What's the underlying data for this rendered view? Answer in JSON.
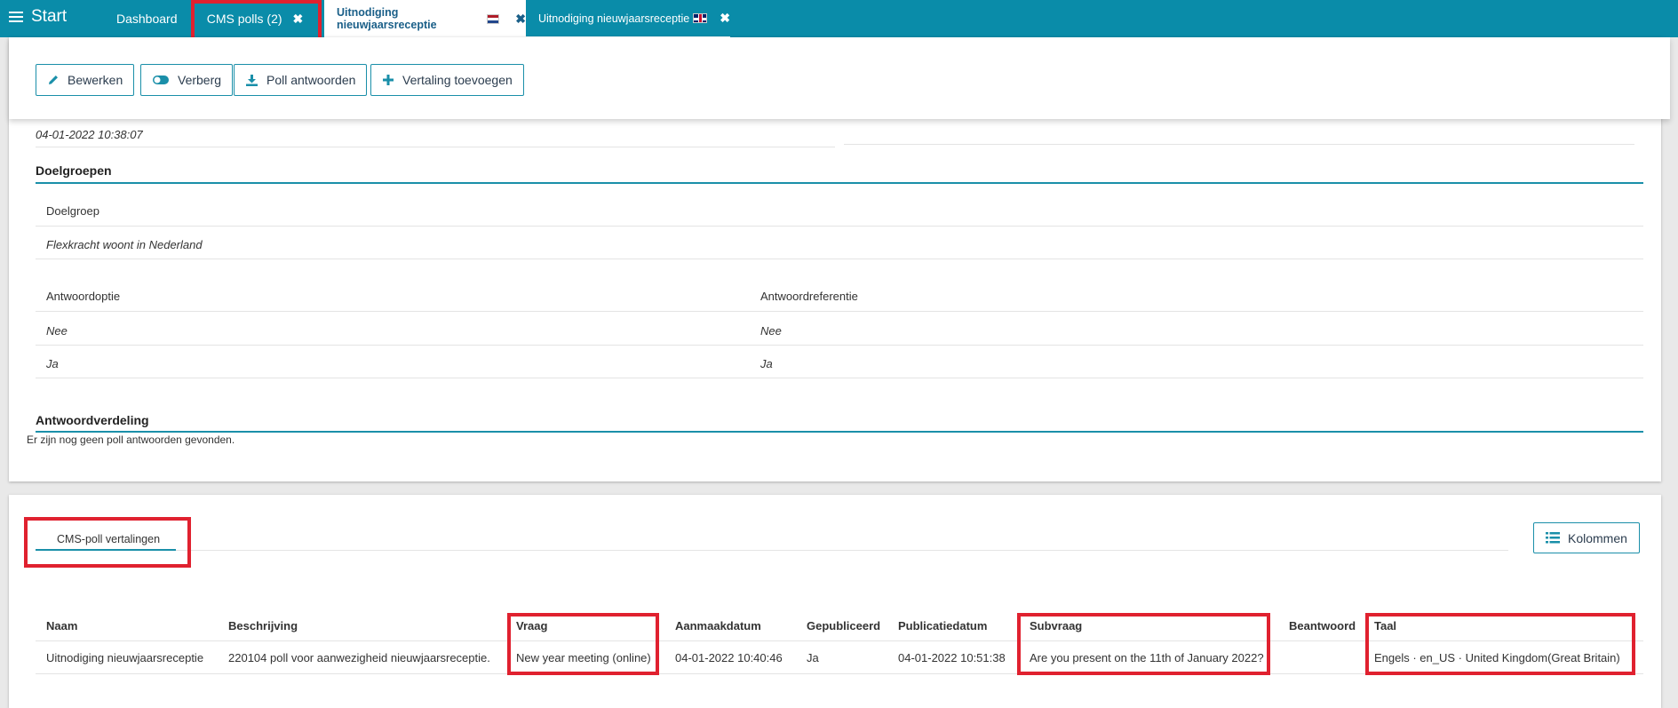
{
  "topbar": {
    "menu_label": "Start",
    "tabs": [
      {
        "label": "Dashboard"
      },
      {
        "label": "CMS polls (2)"
      },
      {
        "label": "Uitnodiging nieuwjaarsreceptie",
        "flag": "nl"
      },
      {
        "label": "Uitnodiging nieuwjaarsreceptie",
        "flag": "uk"
      }
    ]
  },
  "toolbar": {
    "buttons": [
      {
        "label": "Bewerken",
        "icon": "pencil-icon"
      },
      {
        "label": "Verberg",
        "icon": "toggle-icon"
      },
      {
        "label": "Poll antwoorden",
        "icon": "download-icon"
      },
      {
        "label": "Vertaling toevoegen",
        "icon": "plus-icon"
      }
    ]
  },
  "details": {
    "created_value": "04-01-2022 10:38:07",
    "doelgroepen_title": "Doelgroepen",
    "doelgroep_header": "Doelgroep",
    "doelgroep_value": "Flexkracht woont in Nederland",
    "answers_headers": [
      "Antwoordoptie",
      "Antwoordreferentie"
    ],
    "answers": [
      [
        "Nee",
        "Nee"
      ],
      [
        "Ja",
        "Ja"
      ]
    ],
    "verdeling_title": "Antwoordverdeling",
    "verdeling_empty": "Er zijn nog geen poll antwoorden gevonden."
  },
  "translations": {
    "tab_label": "CMS-poll vertalingen",
    "columns_button": "Kolommen",
    "headers": [
      "Naam",
      "Beschrijving",
      "Vraag",
      "Aanmaakdatum",
      "Gepubliceerd",
      "Publicatiedatum",
      "Subvraag",
      "Beantwoord",
      "Taal"
    ],
    "rows": [
      [
        "Uitnodiging nieuwjaarsreceptie",
        "220104 poll voor aanwezigheid nieuwjaarsreceptie.",
        "New year meeting (online)",
        "04-01-2022 10:40:46",
        "Ja",
        "04-01-2022 10:51:38",
        "Are you present on the 11th of January 2022?",
        "",
        "Engels · en_US · United Kingdom(Great Britain)"
      ]
    ]
  },
  "colors": {
    "topbar": "#0a8ca9",
    "accent": "#1a8fa9",
    "highlight": "#e0212f"
  }
}
